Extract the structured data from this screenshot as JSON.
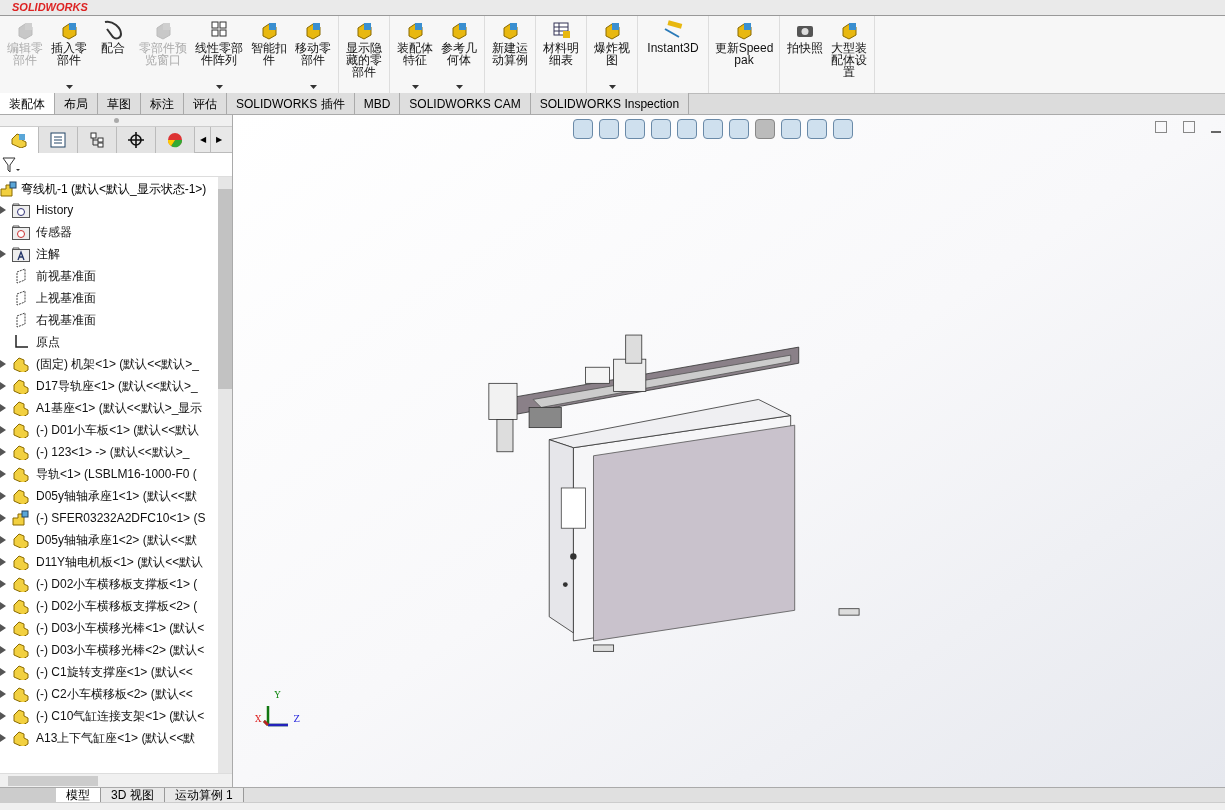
{
  "app": {
    "logo": "SOLIDWORKS"
  },
  "ribbon": {
    "groups": [
      [
        {
          "label": "编辑零部件",
          "disabled": true,
          "menu": false,
          "kind": "edit"
        },
        {
          "label": "插入零部件",
          "disabled": false,
          "menu": true,
          "kind": "insert"
        },
        {
          "label": "配合",
          "disabled": false,
          "menu": false,
          "kind": "mate"
        },
        {
          "label": "零部件预览窗口",
          "disabled": true,
          "menu": false,
          "kind": "preview"
        },
        {
          "label": "线性零部件阵列",
          "disabled": false,
          "menu": true,
          "kind": "pattern"
        },
        {
          "label": "智能扣件",
          "disabled": false,
          "menu": false,
          "kind": "fastener"
        },
        {
          "label": "移动零部件",
          "disabled": false,
          "menu": true,
          "kind": "move"
        }
      ],
      [
        {
          "label": "显示隐藏的零部件",
          "disabled": false,
          "menu": false,
          "kind": "show"
        }
      ],
      [
        {
          "label": "装配体特征",
          "disabled": false,
          "menu": true,
          "kind": "feature"
        },
        {
          "label": "参考几何体",
          "disabled": false,
          "menu": true,
          "kind": "geometry"
        }
      ],
      [
        {
          "label": "新建运动算例",
          "disabled": false,
          "menu": false,
          "kind": "motion"
        }
      ],
      [
        {
          "label": "材料明细表",
          "disabled": false,
          "menu": false,
          "kind": "bom"
        }
      ],
      [
        {
          "label": "爆炸视图",
          "disabled": false,
          "menu": true,
          "kind": "explode"
        }
      ],
      [
        {
          "label": "Instant3D",
          "disabled": false,
          "menu": false,
          "kind": "instant"
        }
      ],
      [
        {
          "label": "更新Speedpak",
          "disabled": false,
          "menu": false,
          "kind": "speedpak"
        }
      ],
      [
        {
          "label": "拍快照",
          "disabled": false,
          "menu": false,
          "kind": "camera"
        },
        {
          "label": "大型装配体设置",
          "disabled": false,
          "menu": false,
          "kind": "large"
        }
      ]
    ]
  },
  "tabs": [
    {
      "label": "装配体",
      "selected": true
    },
    {
      "label": "布局",
      "selected": false
    },
    {
      "label": "草图",
      "selected": false
    },
    {
      "label": "标注",
      "selected": false
    },
    {
      "label": "评估",
      "selected": false
    },
    {
      "label": "SOLIDWORKS 插件",
      "selected": false
    },
    {
      "label": "MBD",
      "selected": false
    },
    {
      "label": "SOLIDWORKS CAM",
      "selected": false
    },
    {
      "label": "SOLIDWORKS Inspection",
      "selected": false
    }
  ],
  "panel_tabs": [
    {
      "kind": "feature-manager",
      "selected": true
    },
    {
      "kind": "property",
      "selected": false
    },
    {
      "kind": "config",
      "selected": false
    },
    {
      "kind": "dim",
      "selected": false
    },
    {
      "kind": "display",
      "selected": false
    }
  ],
  "panel_scroll": {
    "left": "◀",
    "right": "▶"
  },
  "tree": {
    "root": "弯线机-1 (默认<默认_显示状态-1>)",
    "features": [
      {
        "label": "History",
        "kind": "history",
        "expandable": true
      },
      {
        "label": "传感器",
        "kind": "sensor",
        "expandable": false
      },
      {
        "label": "注解",
        "kind": "annotation",
        "expandable": true
      },
      {
        "label": "前视基准面",
        "kind": "plane",
        "expandable": false
      },
      {
        "label": "上视基准面",
        "kind": "plane",
        "expandable": false
      },
      {
        "label": "右视基准面",
        "kind": "plane",
        "expandable": false
      },
      {
        "label": "原点",
        "kind": "origin",
        "expandable": false
      }
    ],
    "components": [
      {
        "label": "(固定) 机架<1> (默认<<默认>_",
        "kind": "part"
      },
      {
        "label": "D17导轨座<1> (默认<<默认>_",
        "kind": "part"
      },
      {
        "label": "A1基座<1> (默认<<默认>_显示",
        "kind": "part"
      },
      {
        "label": "(-) D01小车板<1> (默认<<默认",
        "kind": "part"
      },
      {
        "label": "(-) 123<1> -> (默认<<默认>_",
        "kind": "part"
      },
      {
        "label": "导轨<1> (LSBLM16-1000-F0 (",
        "kind": "part"
      },
      {
        "label": "D05y轴轴承座1<1> (默认<<默",
        "kind": "part"
      },
      {
        "label": "(-) SFER03232A2DFC10<1> (S",
        "kind": "assembly"
      },
      {
        "label": "D05y轴轴承座1<2> (默认<<默",
        "kind": "part"
      },
      {
        "label": "D11Y轴电机板<1> (默认<<默认",
        "kind": "part"
      },
      {
        "label": "(-) D02小车横移板支撑板<1> (",
        "kind": "part"
      },
      {
        "label": "(-) D02小车横移板支撑板<2> (",
        "kind": "part"
      },
      {
        "label": "(-) D03小车横移光棒<1> (默认<",
        "kind": "part"
      },
      {
        "label": "(-) D03小车横移光棒<2> (默认<",
        "kind": "part"
      },
      {
        "label": "(-) C1旋转支撑座<1> (默认<<",
        "kind": "part"
      },
      {
        "label": "(-) C2小车横移板<2> (默认<<",
        "kind": "part"
      },
      {
        "label": "(-) C10气缸连接支架<1> (默认<",
        "kind": "part"
      },
      {
        "label": "A13上下气缸座<1> (默认<<默",
        "kind": "part"
      }
    ]
  },
  "sheet_tabs": [
    {
      "label": "模型",
      "selected": true
    },
    {
      "label": "3D 视图",
      "selected": false
    },
    {
      "label": "运动算例 1",
      "selected": false
    }
  ],
  "triad": {
    "x": "X",
    "y": "Y",
    "z": "Z"
  }
}
